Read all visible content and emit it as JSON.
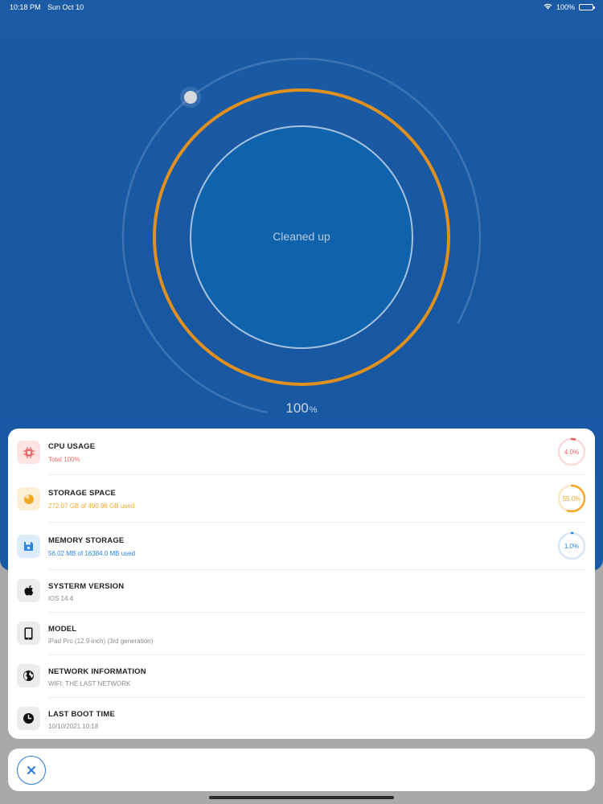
{
  "status_bar": {
    "time": "10:18 PM",
    "date": "Sun Oct 10",
    "battery": "100%",
    "icons": [
      "wifi-icon",
      "battery-icon"
    ]
  },
  "gauge": {
    "label": "Cleaned up",
    "percent_value": "100",
    "percent_unit": "%",
    "progress": 100,
    "colors": {
      "outer_ring": "#6f96c8",
      "middle_ring": "#e0901f",
      "inner_circle": "#0f63ad",
      "inner_ring": "#9fbcdc",
      "knob": "#d6d8dc"
    }
  },
  "info": {
    "rows": [
      {
        "title": "CPU USAGE",
        "subtitle": "Total 100%",
        "icon": "cpu-icon",
        "icon_bg": "#fde3e3",
        "icon_color": "#e96b6b",
        "subtitle_color": "#e96b6b",
        "ring_value": "4.0%",
        "ring_fraction": 0.04,
        "ring_color": "#ec5b5b",
        "ring_track": "#fbdcdc"
      },
      {
        "title": "STORAGE SPACE",
        "subtitle": "272.07 GB of 490.96 GB used",
        "icon": "pie-chart-icon",
        "icon_bg": "#fdefd5",
        "icon_color": "#f3a928",
        "subtitle_color": "#f3a928",
        "ring_value": "55.0%",
        "ring_fraction": 0.55,
        "ring_color": "#f3a928",
        "ring_track": "#fbe9c8"
      },
      {
        "title": "MEMORY STORAGE",
        "subtitle": "56.02 MB of 16384.0 MB used",
        "icon": "floppy-disk-icon",
        "icon_bg": "#dcecfb",
        "icon_color": "#2a84e0",
        "subtitle_color": "#2a84e0",
        "ring_value": "1.0%",
        "ring_fraction": 0.01,
        "ring_color": "#2a84e0",
        "ring_track": "#d6e7f8"
      },
      {
        "title": "SYSTERM VERSION",
        "subtitle": "iOS 14.4",
        "icon": "apple-icon",
        "icon_bg": "#ececec",
        "icon_color": "#111111",
        "subtitle_color": "#8a8a8a"
      },
      {
        "title": "MODEL",
        "subtitle": "iPad Pro (12.9-inch) (3rd generation)",
        "icon": "tablet-icon",
        "icon_bg": "#ececec",
        "icon_color": "#111111",
        "subtitle_color": "#8a8a8a"
      },
      {
        "title": "NETWORK INFORMATION",
        "subtitle": "WIFI: THE LAST NETWORK",
        "icon": "globe-icon",
        "icon_bg": "#ececec",
        "icon_color": "#111111",
        "subtitle_color": "#8a8a8a"
      },
      {
        "title": "LAST BOOT TIME",
        "subtitle": "10/10/2021 10:18",
        "icon": "clock-icon",
        "icon_bg": "#ececec",
        "icon_color": "#111111",
        "subtitle_color": "#8a8a8a"
      }
    ]
  },
  "bottom_bar": {
    "close_icon": "close-icon",
    "accent": "#2a78d6"
  }
}
